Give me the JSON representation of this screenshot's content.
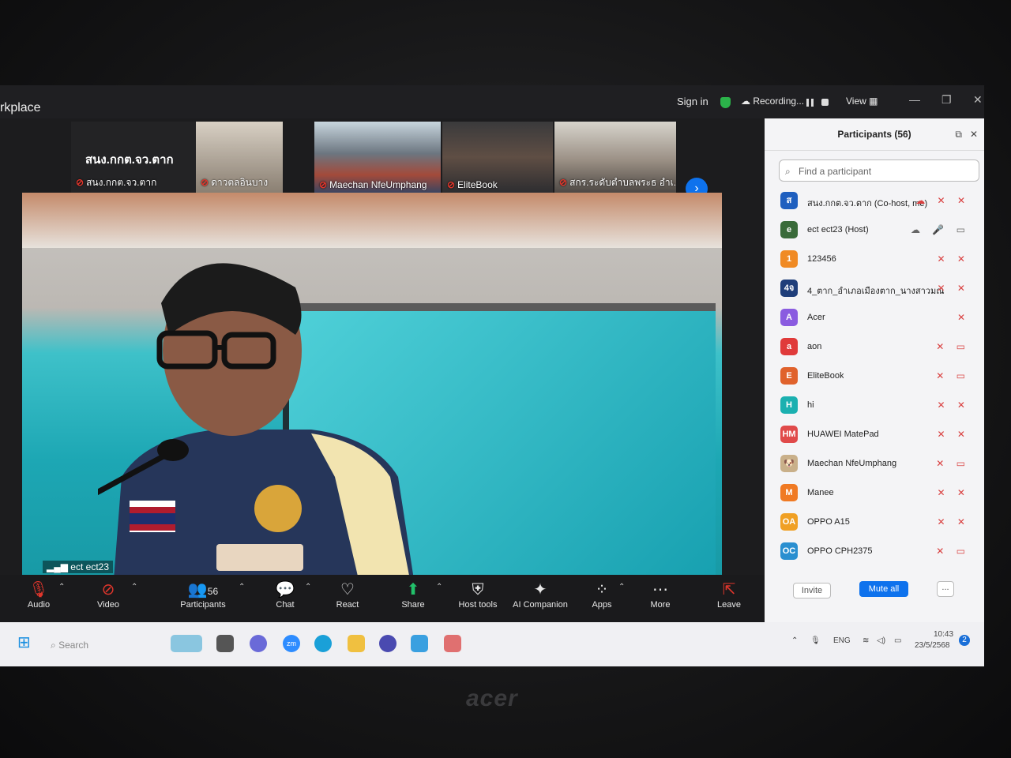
{
  "window": {
    "app_title": "rkplace",
    "sign_in": "Sign in",
    "recording": "Recording...",
    "view": "View"
  },
  "thumbnails": [
    {
      "title": "สนง.กกต.จว.ตาก",
      "label": "สนง.กกต.จว.ตาก"
    },
    {
      "label": "ดาวตลอินบาง"
    },
    {
      "label": "Maechan NfeUmphang"
    },
    {
      "label": "EliteBook"
    },
    {
      "label": "สกร.ระดับตำบลพระธ อำเ..."
    }
  ],
  "main_video": {
    "speaker_label": "ect ect23"
  },
  "toolbar": {
    "audio": "Audio",
    "video": "Video",
    "participants_count": "56",
    "participants": "Participants",
    "chat": "Chat",
    "react": "React",
    "share": "Share",
    "host_tools": "Host tools",
    "ai_companion": "AI Companion",
    "apps": "Apps",
    "more": "More",
    "leave": "Leave"
  },
  "participants_panel": {
    "title": "Participants (56)",
    "search_placeholder": "Find a participant",
    "items": [
      {
        "avatar": "ส",
        "color": "#1f5fbf",
        "name": "สนง.กกต.จว.ตาก (Co-host, me)",
        "status": "☁ ✕ ✕"
      },
      {
        "avatar": "e",
        "color": "#3a6b3a",
        "name": "ect ect23 (Host)",
        "status": "☁ 🎤 ▭"
      },
      {
        "avatar": "1",
        "color": "#f08a24",
        "name": "123456",
        "status": "✕ ✕"
      },
      {
        "avatar": "4จ",
        "color": "#1f3e7a",
        "name": "4_ตาก_อำเภอเมืองตาก_นางสาวมณฑ...",
        "status": "✕ ✕"
      },
      {
        "avatar": "A",
        "color": "#8a5be0",
        "name": "Acer",
        "status": "✕"
      },
      {
        "avatar": "a",
        "color": "#e03a3a",
        "name": "aon",
        "status": "✕ ▭"
      },
      {
        "avatar": "E",
        "color": "#e0622c",
        "name": "EliteBook",
        "status": "✕ ▭"
      },
      {
        "avatar": "H",
        "color": "#1bb0b0",
        "name": "hi",
        "status": "✕ ✕"
      },
      {
        "avatar": "HM",
        "color": "#e04a4a",
        "name": "HUAWEI MatePad",
        "status": "✕ ✕"
      },
      {
        "avatar": "🐶",
        "color": "#c9b08a",
        "name": "Maechan NfeUmphang",
        "status": "✕ ▭"
      },
      {
        "avatar": "M",
        "color": "#f07a24",
        "name": "Manee",
        "status": "✕ ✕"
      },
      {
        "avatar": "OA",
        "color": "#f0a024",
        "name": "OPPO A15",
        "status": "✕ ✕"
      },
      {
        "avatar": "OC",
        "color": "#2a8fd0",
        "name": "OPPO CPH2375",
        "status": "✕ ▭"
      }
    ],
    "invite": "Invite",
    "mute_all": "Mute all",
    "more": "..."
  },
  "taskbar": {
    "search": "Search",
    "lang": "ENG",
    "time": "10:43",
    "date": "23/5/2568",
    "notification_count": "2"
  },
  "bezel": {
    "brand": "acer"
  }
}
